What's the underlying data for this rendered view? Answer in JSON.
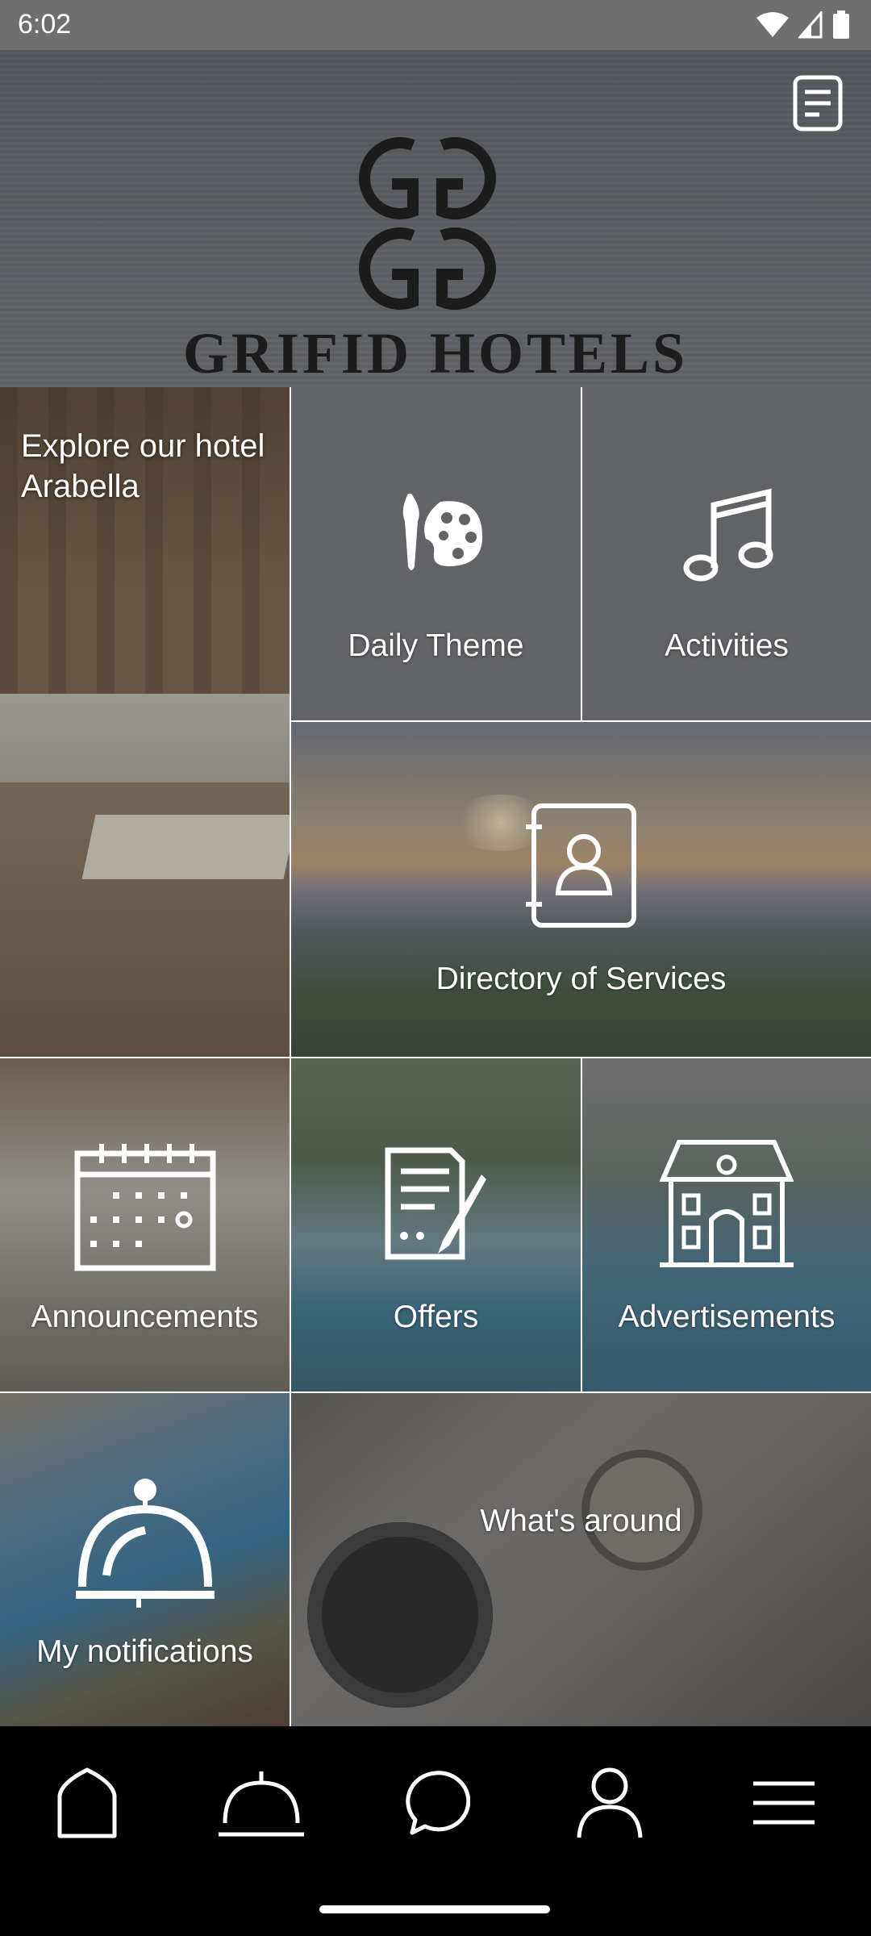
{
  "status_bar": {
    "time": "6:02",
    "icons": [
      "wifi-icon",
      "signal-icon",
      "battery-icon"
    ]
  },
  "header": {
    "brand_name": "GRIFID HOTELS",
    "logo": "double-G monogram",
    "document_button_icon": "document-icon"
  },
  "tiles": {
    "explore": {
      "label": "Explore our hotel Arabella"
    },
    "daily_theme": {
      "label": "Daily Theme",
      "icon": "palette-icon"
    },
    "activities": {
      "label": "Activities",
      "icon": "music-note-icon"
    },
    "directory": {
      "label": "Directory of Services",
      "icon": "contact-book-icon"
    },
    "announcements": {
      "label": "Announcements",
      "icon": "calendar-icon"
    },
    "offers": {
      "label": "Offers",
      "icon": "document-edit-icon"
    },
    "advertisements": {
      "label": "Advertisements",
      "icon": "house-icon"
    },
    "notifications": {
      "label": "My notifications",
      "icon": "service-bell-icon"
    },
    "whats_around": {
      "label": "What's around",
      "icon": "compass-map"
    }
  },
  "bottom_nav": {
    "items": [
      "home-icon",
      "service-bell-icon",
      "chat-icon",
      "profile-icon",
      "menu-icon"
    ]
  },
  "colors": {
    "status_bar": "#6f6f6f",
    "header_bg": "#585b60",
    "nav_bg": "#000000",
    "text": "#ffffff"
  }
}
